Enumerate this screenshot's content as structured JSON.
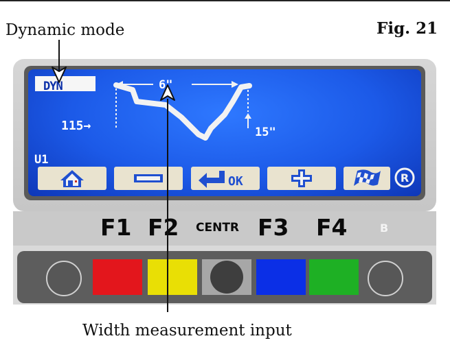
{
  "figure": {
    "title": "Fig. 21",
    "callouts": {
      "mode": "Dynamic mode",
      "width": "Width measurement input"
    }
  },
  "screen": {
    "mode": "DYN",
    "width_value": "6\"",
    "offset_value": "115→",
    "rim_value": "15\"",
    "user": "U1",
    "softkeys": [
      {
        "name": "home",
        "icon": "home-icon"
      },
      {
        "name": "minus",
        "icon": "minus-icon"
      },
      {
        "name": "ok",
        "icon": "enter-ok-icon",
        "label": "OK"
      },
      {
        "name": "plus",
        "icon": "plus-icon"
      },
      {
        "name": "flag",
        "icon": "checkered-flag-icon"
      }
    ],
    "status_icon": "registered-icon",
    "colors": {
      "screen": "#1c5ae8",
      "softkey": "#e9e3cf",
      "text": "#ffffff"
    }
  },
  "function_keys": {
    "f1": "F1",
    "f2": "F2",
    "centr": "CENTR",
    "f3": "F3",
    "f4": "F4",
    "b": "B"
  },
  "keypad": {
    "colors": {
      "red": "#e3161c",
      "yellow": "#e9df05",
      "grey": "#a7a7a7",
      "blue": "#0b2fe6",
      "green": "#1eb024"
    }
  }
}
